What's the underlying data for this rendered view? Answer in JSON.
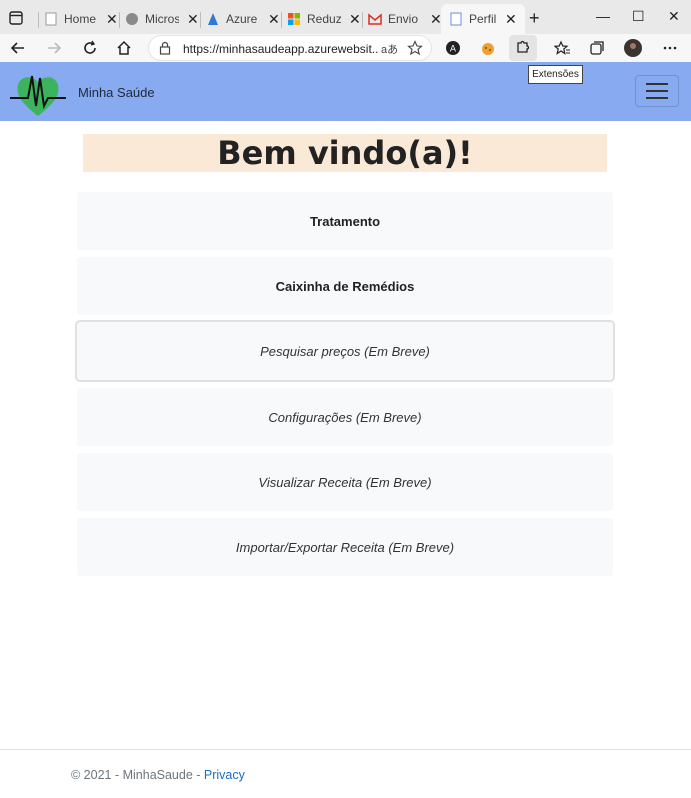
{
  "browser": {
    "tabs": [
      {
        "title": "Home",
        "icon": "page-icon"
      },
      {
        "title": "Micros",
        "icon": "microsoft-icon"
      },
      {
        "title": "Azure",
        "icon": "azure-icon"
      },
      {
        "title": "Reduz",
        "icon": "windows-icon"
      },
      {
        "title": "Envio",
        "icon": "gmail-icon"
      },
      {
        "title": "Perfil P",
        "icon": "page-icon",
        "active": true
      }
    ],
    "url": "https://minhasaudeapp.azurewebsit...",
    "read_aloud": "aあ",
    "tooltip": "Extensões"
  },
  "navbar": {
    "brand": "Minha Saúde",
    "colors": {
      "navbar": "#87aaf0",
      "heart": "#3cb35e"
    }
  },
  "main": {
    "welcome": "Bem vindo(a)!",
    "buttons": [
      {
        "label": "Tratamento"
      },
      {
        "label": "Caixinha de Remédios"
      },
      {
        "label": "Pesquisar preços (Em Breve)"
      },
      {
        "label": "Configurações (Em Breve)"
      },
      {
        "label": "Visualizar Receita (Em Breve)"
      },
      {
        "label": "Importar/Exportar Receita (Em Breve)"
      }
    ]
  },
  "footer": {
    "copyright": "© 2021 - MinhaSaude - ",
    "privacy": "Privacy"
  }
}
